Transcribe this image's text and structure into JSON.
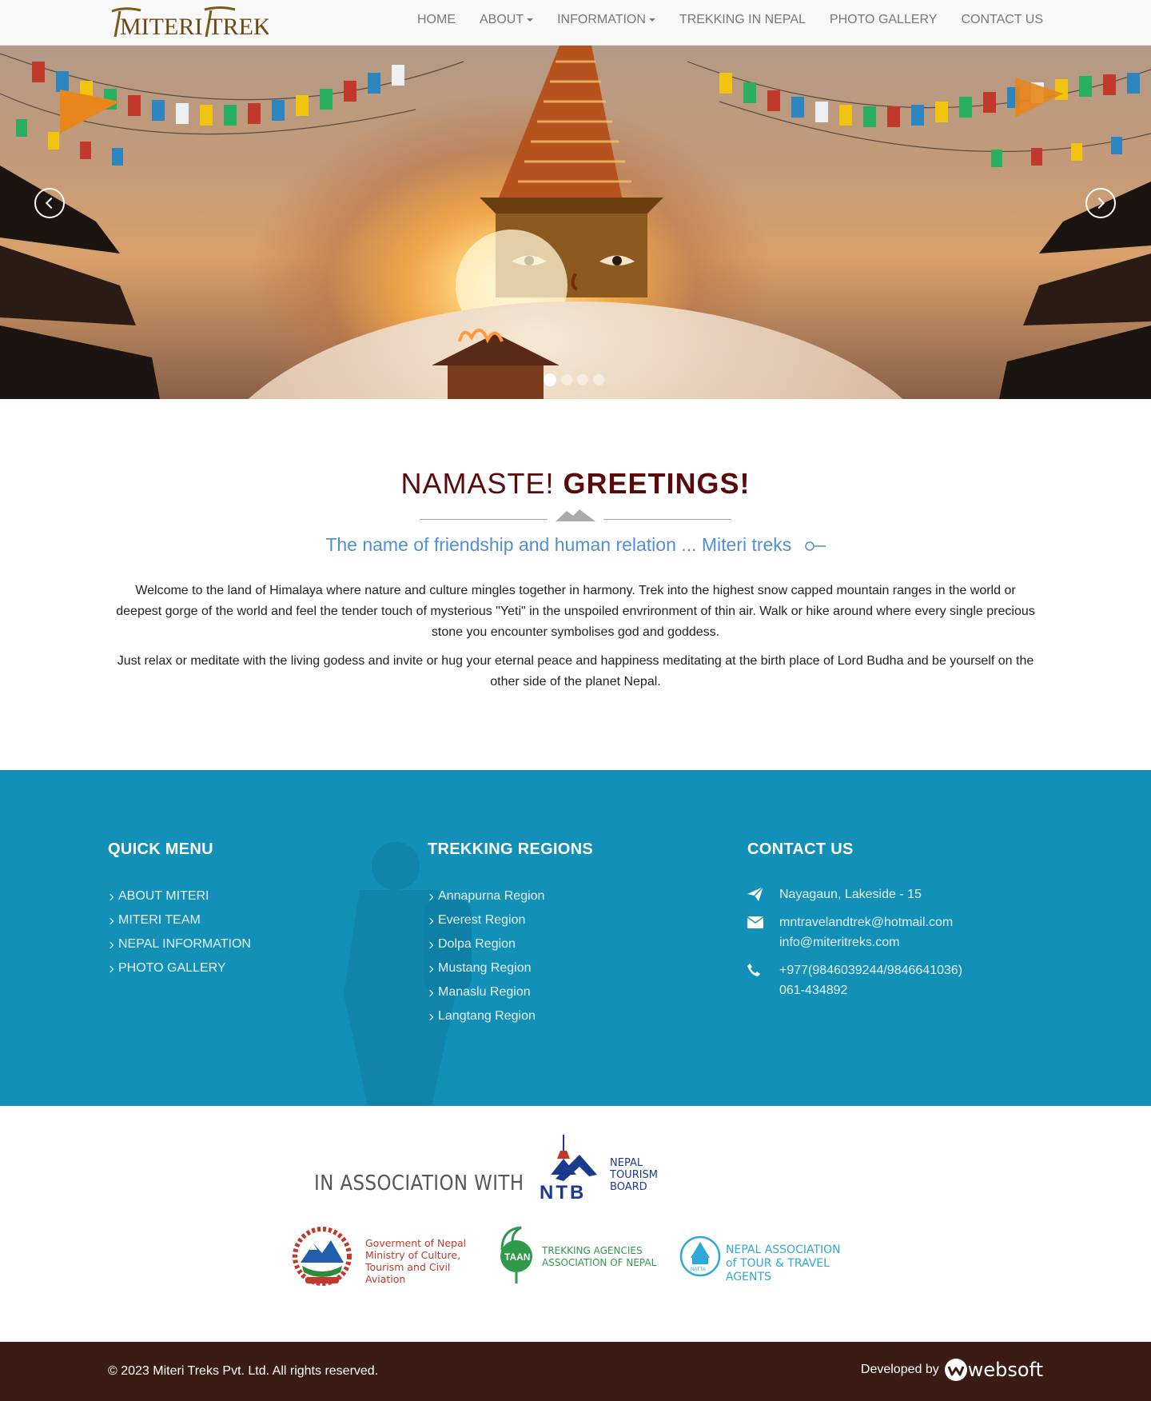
{
  "nav": {
    "logo_text": "MITERI TREKS",
    "items": [
      {
        "label": "HOME",
        "dropdown": false
      },
      {
        "label": "ABOUT",
        "dropdown": true
      },
      {
        "label": "INFORMATION",
        "dropdown": true
      },
      {
        "label": "TREKKING IN NEPAL",
        "dropdown": false
      },
      {
        "label": "PHOTO GALLERY",
        "dropdown": false
      },
      {
        "label": "CONTACT US",
        "dropdown": false
      }
    ]
  },
  "hero": {
    "slides": 4,
    "active_slide": 1,
    "prev_icon": "chevron-left-icon",
    "next_icon": "chevron-right-icon"
  },
  "welcome": {
    "title_light": "NAMASTE!",
    "title_bold": "GREETINGS!",
    "tagline": "The name of friendship and human relation ... Miteri treks",
    "paragraphs": [
      "Welcome to the land of Himalaya where nature and culture mingles together in harmony. Trek into the highest snow capped mountain ranges in the world or deepest gorge of the world and feel the tender touch of mysterious \"Yeti\" in the unspoiled envrironment of thin air. Walk or hike around where every single precious stone you encounter symbolises god and goddess.",
      "Just relax or meditate with the living godess and invite or hug your eternal peace and happiness meditating at the birth place of Lord Budha and be yourself on the other side of the planet Nepal."
    ]
  },
  "footer": {
    "quick_menu": {
      "title": "QUICK MENU",
      "items": [
        "ABOUT MITERI",
        "MITERI TEAM",
        "NEPAL INFORMATION",
        "PHOTO GALLERY"
      ]
    },
    "regions": {
      "title": "TREKKING REGIONS",
      "items": [
        "Annapurna Region",
        "Everest Region",
        "Dolpa Region",
        "Mustang Region",
        "Manaslu Region",
        "Langtang Region"
      ]
    },
    "contact": {
      "title": "CONTACT US",
      "address": "Nayagaun, Lakeside - 15",
      "email1": "mntravelandtrek@hotmail.com",
      "email2": "info@miteritreks.com",
      "phone1": "+977(9846039244/9846641036)",
      "phone2": "061-434892"
    },
    "colors": {
      "background": "#1290b8"
    }
  },
  "association": {
    "title": "IN ASSOCIATION WITH",
    "ntb": {
      "letters": "NTB",
      "line1": "NEPAL",
      "line2": "TOURISM",
      "line3": "BOARD"
    },
    "gov": {
      "line1": "Goverment of Nepal",
      "line2": "Ministry of Culture,",
      "line3": "Tourism and Civil Aviation"
    },
    "taan": {
      "badge": "TAAN",
      "line1": "TREKKING AGENCIES",
      "line2": "ASSOCIATION OF NEPAL"
    },
    "natta": {
      "badge": "NATTA",
      "line1": "NEPAL ASSOCIATION",
      "line2": "of TOUR & TRAVEL AGENTS"
    }
  },
  "bottom": {
    "copyright": "© 2023 Miteri Treks Pvt. Ltd. All rights reserved.",
    "developed_by": "Developed by",
    "developer": "websoft"
  }
}
